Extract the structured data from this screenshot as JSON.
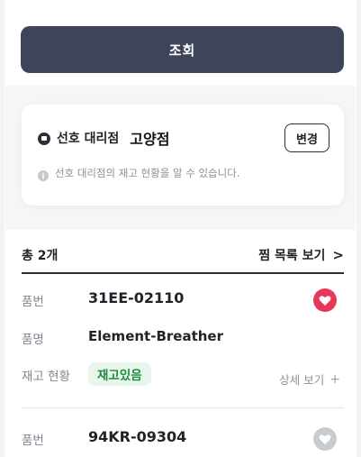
{
  "main_button": {
    "label": "조회"
  },
  "store": {
    "label": "선호 대리점",
    "name": "고양점",
    "change_label": "변경",
    "info": "선호 대리점의 재고 현황을 알 수 있습니다.",
    "icons": {
      "store": "store-icon",
      "info": "info-icon"
    }
  },
  "results": {
    "count_label": "총 2개",
    "wishlist_label": "찜 목록 보기",
    "wishlist_chevron": ">"
  },
  "items": [
    {
      "part_no_label": "품번",
      "part_no": "31EE-02110",
      "name_label": "품명",
      "name": "Element-Breather",
      "stock_label": "재고 현황",
      "stock_status": "재고있음",
      "detail_label": "상세 보기",
      "detail_plus": "+",
      "favorited": true
    },
    {
      "part_no_label": "품번",
      "part_no": "94KR-09304",
      "favorited": false
    }
  ],
  "colors": {
    "primary_button": "#3e4459",
    "heart_active": "#e8385a",
    "heart_inactive": "#c8cbd0",
    "badge_bg": "#e8f6ec",
    "badge_text": "#1e8a3c"
  }
}
